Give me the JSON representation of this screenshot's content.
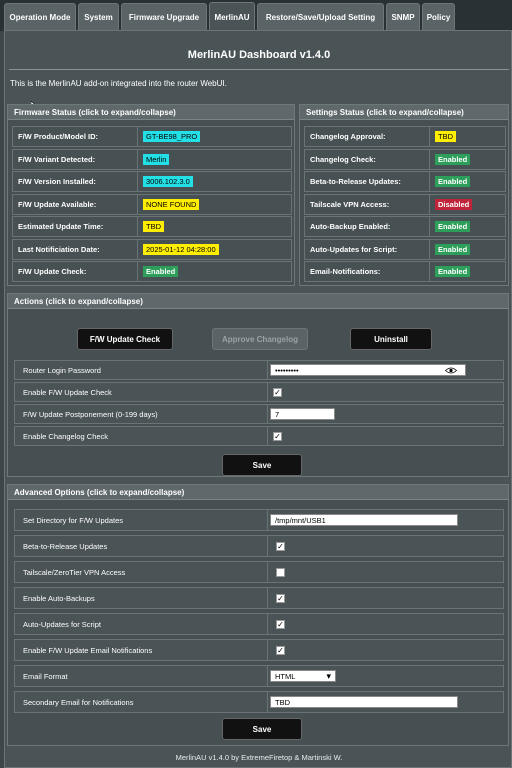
{
  "tabs": [
    "Operation Mode",
    "System",
    "Firmware Upgrade",
    "MerlinAU",
    "Restore/Save/Upload Setting",
    "SNMP",
    "Policy"
  ],
  "title": "MerlinAU Dashboard v1.4.0",
  "intro": "This is the MerlinAU add-on integrated into the router WebUI.",
  "firmware_status": {
    "heading": "Firmware Status (click to expand/collapse)",
    "rows": [
      {
        "label": "F/W Product/Model ID:",
        "value": "GT-BE98_PRO",
        "color": "#23e0e6"
      },
      {
        "label": "F/W Variant Detected:",
        "value": "Merlin",
        "color": "#23e0e6"
      },
      {
        "label": "F/W Version Installed:",
        "value": "3006.102.3.0",
        "color": "#23e0e6"
      },
      {
        "label": "F/W Update Available:",
        "value": "NONE FOUND",
        "color": "#ffee00"
      },
      {
        "label": "Estimated Update Time:",
        "value": "TBD",
        "color": "#ffee00"
      },
      {
        "label": "Last Notificiation Date:",
        "value": "2025-01-12 04:28:00",
        "color": "#ffee00"
      },
      {
        "label": "F/W Update Check:",
        "value": "Enabled",
        "color": "#2e9e5b"
      }
    ]
  },
  "settings_status": {
    "heading": "Settings Status (click to expand/collapse)",
    "rows": [
      {
        "label": "Changelog Approval:",
        "value": "TBD",
        "color": "#ffee00"
      },
      {
        "label": "Changelog Check:",
        "value": "Enabled",
        "color": "#2e9e5b"
      },
      {
        "label": "Beta-to-Release Updates:",
        "value": "Enabled",
        "color": "#2e9e5b"
      },
      {
        "label": "Tailscale VPN Access:",
        "value": "Disabled",
        "color": "#c0243a"
      },
      {
        "label": "Auto-Backup Enabled:",
        "value": "Enabled",
        "color": "#2e9e5b"
      },
      {
        "label": "Auto-Updates for Script:",
        "value": "Enabled",
        "color": "#2e9e5b"
      },
      {
        "label": "Email-Notifications:",
        "value": "Enabled",
        "color": "#2e9e5b"
      }
    ]
  },
  "actions": {
    "heading": "Actions (click to expand/collapse)",
    "check_btn": "F/W Update Check",
    "approve_btn": "Approve Changelog",
    "uninstall_btn": "Uninstall",
    "password_label": "Router Login Password",
    "password_value": "•••••••••",
    "enable_check_label": "Enable F/W Update Check",
    "postpone_label": "F/W Update Postponement (0-199 days)",
    "postpone_value": "7",
    "changelog_label": "Enable Changelog Check",
    "save": "Save"
  },
  "advanced": {
    "heading": "Advanced Options (click to expand/collapse)",
    "dir_label": "Set Directory for F/W Updates",
    "dir_value": "/tmp/mnt/USB1",
    "beta_label": "Beta-to-Release Updates",
    "tailscale_label": "Tailscale/ZeroTier VPN Access",
    "autobackup_label": "Enable Auto-Backups",
    "autoupdate_label": "Auto-Updates for Script",
    "email_notif_label": "Enable F/W Update Email Notifications",
    "email_format_label": "Email Format",
    "email_format_value": "HTML",
    "secondary_label": "Secondary Email for Notifications",
    "secondary_value": "TBD",
    "save": "Save"
  },
  "footer": "MerlinAU v1.4.0 by ExtremeFiretop & Martinski W.",
  "checkmark": "✓",
  "dropdown_arrow": "▾",
  "colors": {
    "bg": "#3e4649",
    "panel": "#464f52",
    "accent_cyan": "#23e0e6",
    "accent_yellow": "#ffee00",
    "accent_green": "#2e9e5b",
    "accent_red": "#c0243a"
  }
}
